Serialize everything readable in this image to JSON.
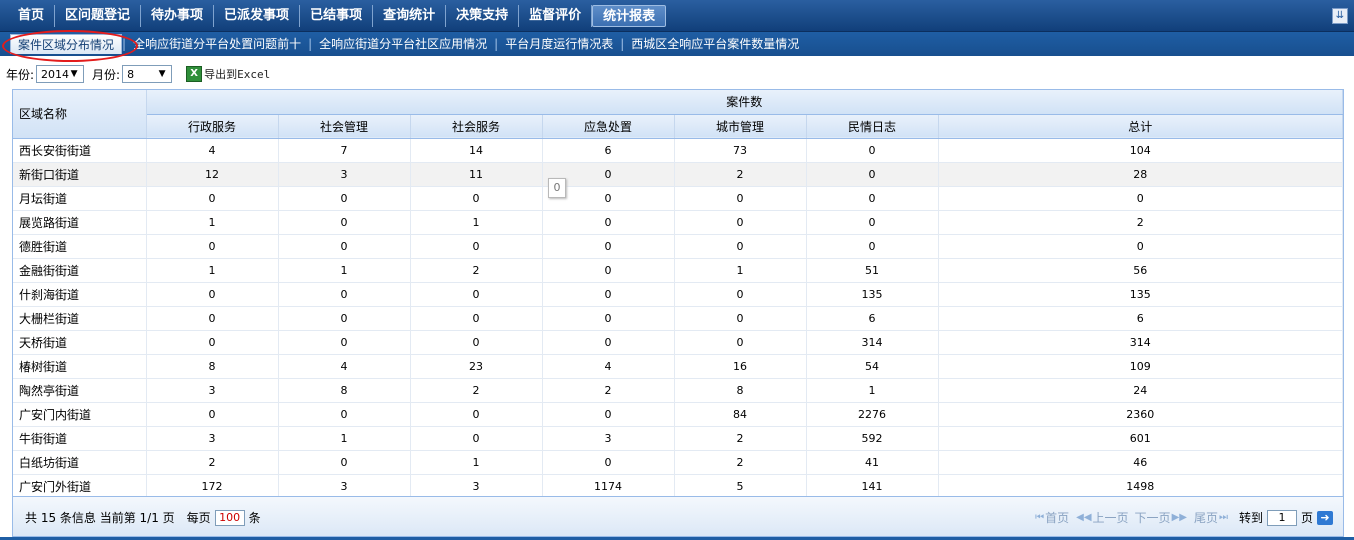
{
  "topnav": {
    "items": [
      "首页",
      "区问题登记",
      "待办事项",
      "已派发事项",
      "已结事项",
      "查询统计",
      "决策支持",
      "监督评价",
      "统计报表"
    ],
    "active_index": 8,
    "collapse_icon": "double-chevron-down-icon"
  },
  "subnav": {
    "items": [
      "案件区域分布情况",
      "全响应街道分平台处置问题前十",
      "全响应街道分平台社区应用情况",
      "平台月度运行情况表",
      "西城区全响应平台案件数量情况"
    ],
    "active_index": 0
  },
  "filter": {
    "year_label": "年份:",
    "year_value": "2014",
    "month_label": "月份:",
    "month_value": "8",
    "export_label": "导出到Excel",
    "export_icon": "excel-icon"
  },
  "table": {
    "region_header": "区域名称",
    "group_header": "案件数",
    "columns": [
      "行政服务",
      "社会管理",
      "社会服务",
      "应急处置",
      "城市管理",
      "民情日志",
      "总计"
    ],
    "rows": [
      {
        "name": "西长安街街道",
        "values": [
          "4",
          "7",
          "14",
          "6",
          "73",
          "0",
          "104"
        ]
      },
      {
        "name": "新街口街道",
        "values": [
          "12",
          "3",
          "11",
          "0",
          "2",
          "0",
          "28"
        ]
      },
      {
        "name": "月坛街道",
        "values": [
          "0",
          "0",
          "0",
          "0",
          "0",
          "0",
          "0"
        ]
      },
      {
        "name": "展览路街道",
        "values": [
          "1",
          "0",
          "1",
          "0",
          "0",
          "0",
          "2"
        ]
      },
      {
        "name": "德胜街道",
        "values": [
          "0",
          "0",
          "0",
          "0",
          "0",
          "0",
          "0"
        ]
      },
      {
        "name": "金融街街道",
        "values": [
          "1",
          "1",
          "2",
          "0",
          "1",
          "51",
          "56"
        ]
      },
      {
        "name": "什刹海街道",
        "values": [
          "0",
          "0",
          "0",
          "0",
          "0",
          "135",
          "135"
        ]
      },
      {
        "name": "大栅栏街道",
        "values": [
          "0",
          "0",
          "0",
          "0",
          "0",
          "6",
          "6"
        ]
      },
      {
        "name": "天桥街道",
        "values": [
          "0",
          "0",
          "0",
          "0",
          "0",
          "314",
          "314"
        ]
      },
      {
        "name": "椿树街道",
        "values": [
          "8",
          "4",
          "23",
          "4",
          "16",
          "54",
          "109"
        ]
      },
      {
        "name": "陶然亭街道",
        "values": [
          "3",
          "8",
          "2",
          "2",
          "8",
          "1",
          "24"
        ]
      },
      {
        "name": "广安门内街道",
        "values": [
          "0",
          "0",
          "0",
          "0",
          "84",
          "2276",
          "2360"
        ]
      },
      {
        "name": "牛街街道",
        "values": [
          "3",
          "1",
          "0",
          "3",
          "2",
          "592",
          "601"
        ]
      },
      {
        "name": "白纸坊街道",
        "values": [
          "2",
          "0",
          "1",
          "0",
          "2",
          "41",
          "46"
        ]
      },
      {
        "name": "广安门外街道",
        "values": [
          "172",
          "3",
          "3",
          "1174",
          "5",
          "141",
          "1498"
        ]
      }
    ],
    "highlight_row": 1,
    "tooltip_value": "0"
  },
  "footer": {
    "info_prefix": "共 15 条信息 当前第 1/1 页",
    "per_page_label": "每页",
    "per_page_value": "100",
    "per_page_unit": "条",
    "first": "首页",
    "prev": "上一页",
    "next": "下一页",
    "last": "尾页",
    "goto_label": "转到",
    "page_value": "1",
    "page_unit": "页",
    "go_icon": "arrow-right-icon"
  }
}
